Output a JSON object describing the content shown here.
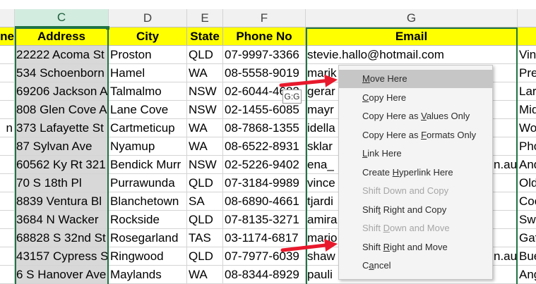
{
  "columns": [
    {
      "letter": "",
      "header": "ne",
      "selected": false
    },
    {
      "letter": "C",
      "header": "Address",
      "selected": true
    },
    {
      "letter": "D",
      "header": "City",
      "selected": false
    },
    {
      "letter": "E",
      "header": "State",
      "selected": false
    },
    {
      "letter": "F",
      "header": "Phone No",
      "selected": false
    },
    {
      "letter": "G",
      "header": "Email",
      "selected": false
    },
    {
      "letter": "",
      "header": "",
      "selected": false
    }
  ],
  "rows": [
    {
      "a": "",
      "address": "22222 Acoma St",
      "city": "Proston",
      "state": "QLD",
      "phone": "07-9997-3366",
      "email": "stevie.hallo@hotmail.com",
      "h": "Vin"
    },
    {
      "a": "",
      "address": "534 Schoenborn",
      "city": "Hamel",
      "state": "WA",
      "phone": "08-5558-9019",
      "email": "marik",
      "h": "Pre"
    },
    {
      "a": "",
      "address": "69206 Jackson A",
      "city": "Talmalmo",
      "state": "NSW",
      "phone": "02-6044-4682",
      "email": "gerar",
      "h": "Lar"
    },
    {
      "a": "",
      "address": "808 Glen Cove A",
      "city": "Lane Cove",
      "state": "NSW",
      "phone": "02-1455-6085",
      "email": "mayr",
      "h": "Mid"
    },
    {
      "a": "n",
      "address": "373 Lafayette St",
      "city": "Cartmeticup",
      "state": "WA",
      "phone": "08-7868-1355",
      "email": "idella",
      "h": "Wo"
    },
    {
      "a": "",
      "address": "87 Sylvan Ave",
      "city": "Nyamup",
      "state": "WA",
      "phone": "08-6522-8931",
      "email": "sklar",
      "h": "Pho"
    },
    {
      "a": "",
      "address": "60562 Ky Rt 321",
      "city": "Bendick Murr",
      "state": "NSW",
      "phone": "02-5226-9402",
      "email": "ena_",
      "h": "And"
    },
    {
      "a": "",
      "address": "70 S 18th Pl",
      "city": "Purrawunda",
      "state": "QLD",
      "phone": "07-3184-9989",
      "email": "vince",
      "h": "Old"
    },
    {
      "a": "",
      "address": "8839 Ventura Bl",
      "city": "Blanchetown",
      "state": "SA",
      "phone": "08-6890-4661",
      "email": "tjardi",
      "h": "Coo"
    },
    {
      "a": "",
      "address": "3684 N Wacker",
      "city": "Rockside",
      "state": "QLD",
      "phone": "07-8135-3271",
      "email": "amira",
      "h": "Swa"
    },
    {
      "a": "",
      "address": "68828 S 32nd St",
      "city": "Rosegarland",
      "state": "TAS",
      "phone": "03-1174-6817",
      "email": "mario",
      "h": "Gat"
    },
    {
      "a": "",
      "address": "43157 Cypress S",
      "city": "Ringwood",
      "state": "QLD",
      "phone": "07-7977-6039",
      "email": "shaw",
      "h": "Bue"
    },
    {
      "a": "",
      "address": "6 S Hanover Ave",
      "city": "Maylands",
      "state": "WA",
      "phone": "08-8344-8929",
      "email": "pauli",
      "h": "Ang"
    }
  ],
  "email_overflow": [
    {
      "row": 6,
      "text": "n.au"
    },
    {
      "row": 11,
      "text": "n.au"
    }
  ],
  "tooltip": "G:G",
  "context_menu": {
    "items": [
      {
        "label": "Move Here",
        "key": "M",
        "pre": "",
        "post": "ove Here",
        "enabled": true,
        "highlighted": true
      },
      {
        "label": "Copy Here",
        "key": "C",
        "pre": "",
        "post": "opy Here",
        "enabled": true,
        "highlighted": false
      },
      {
        "label": "Copy Here as Values Only",
        "key": "V",
        "pre": "Copy Here as ",
        "post": "alues Only",
        "enabled": true,
        "highlighted": false
      },
      {
        "label": "Copy Here as Formats Only",
        "key": "F",
        "pre": "Copy Here as ",
        "post": "ormats Only",
        "enabled": true,
        "highlighted": false
      },
      {
        "label": "Link Here",
        "key": "L",
        "pre": "",
        "post": "ink Here",
        "enabled": true,
        "highlighted": false
      },
      {
        "label": "Create Hyperlink Here",
        "key": "H",
        "pre": "Create ",
        "post": "yperlink Here",
        "enabled": true,
        "highlighted": false
      },
      {
        "label": "Shift Down and Copy",
        "key": "",
        "pre": "Shift Down and Copy",
        "post": "",
        "enabled": false,
        "highlighted": false
      },
      {
        "label": "Shift Right and Copy",
        "key": "t",
        "pre": "Shif",
        "post": " Right and Copy",
        "enabled": true,
        "highlighted": false
      },
      {
        "label": "Shift Down and Move",
        "key": "D",
        "pre": "Shift ",
        "post": "own and Move",
        "enabled": false,
        "highlighted": false
      },
      {
        "label": "Shift Right and Move",
        "key": "R",
        "pre": "Shift ",
        "post": "ight and Move",
        "enabled": true,
        "highlighted": false
      },
      {
        "label": "Cancel",
        "key": "a",
        "pre": "C",
        "post": "ncel",
        "enabled": true,
        "highlighted": false
      }
    ]
  },
  "colors": {
    "header_fill": "#ffff00",
    "selection_border": "#217346",
    "selected_column_fill": "#d8d8d8",
    "arrow": "#e8192c",
    "menu_highlight": "#c6c6c6"
  }
}
